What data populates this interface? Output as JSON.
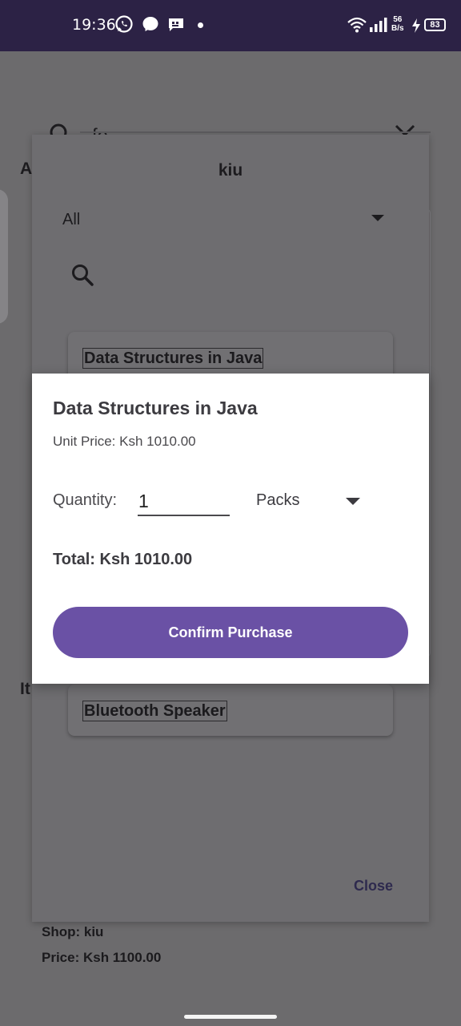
{
  "status_bar": {
    "time": "19:36",
    "net_speed_value": "56",
    "net_speed_unit": "B/s",
    "battery": "83"
  },
  "background_screen": {
    "search_query": "fe",
    "section_heading_partial": "A",
    "items_heading_partial": "It",
    "shop_line": "Shop: kiu",
    "price_line": "Price: Ksh 1100.00"
  },
  "shop_dialog": {
    "title": "kiu",
    "filter_selected": "All",
    "items": [
      {
        "name": "Data Structures in Java"
      },
      {
        "name": "Bluetooth Speaker"
      }
    ],
    "close_label": "Close"
  },
  "purchase_dialog": {
    "title": "Data Structures in Java",
    "unit_price": "Unit Price: Ksh 1010.00",
    "quantity_label": "Quantity:",
    "quantity_value": "1",
    "unit_selected": "Packs",
    "total": "Total: Ksh 1010.00",
    "confirm_label": "Confirm Purchase"
  },
  "colors": {
    "status_bar_bg": "#2c2245",
    "accent": "#6a51a5",
    "scrim": "#6b6a6c"
  },
  "icons": {
    "status": [
      "whatsapp-icon",
      "messenger-icon",
      "message-icon",
      "wifi-icon",
      "signal-icon",
      "charging-icon"
    ],
    "search": "search-icon",
    "clear": "close-icon",
    "dropdown": "caret-down-icon"
  }
}
